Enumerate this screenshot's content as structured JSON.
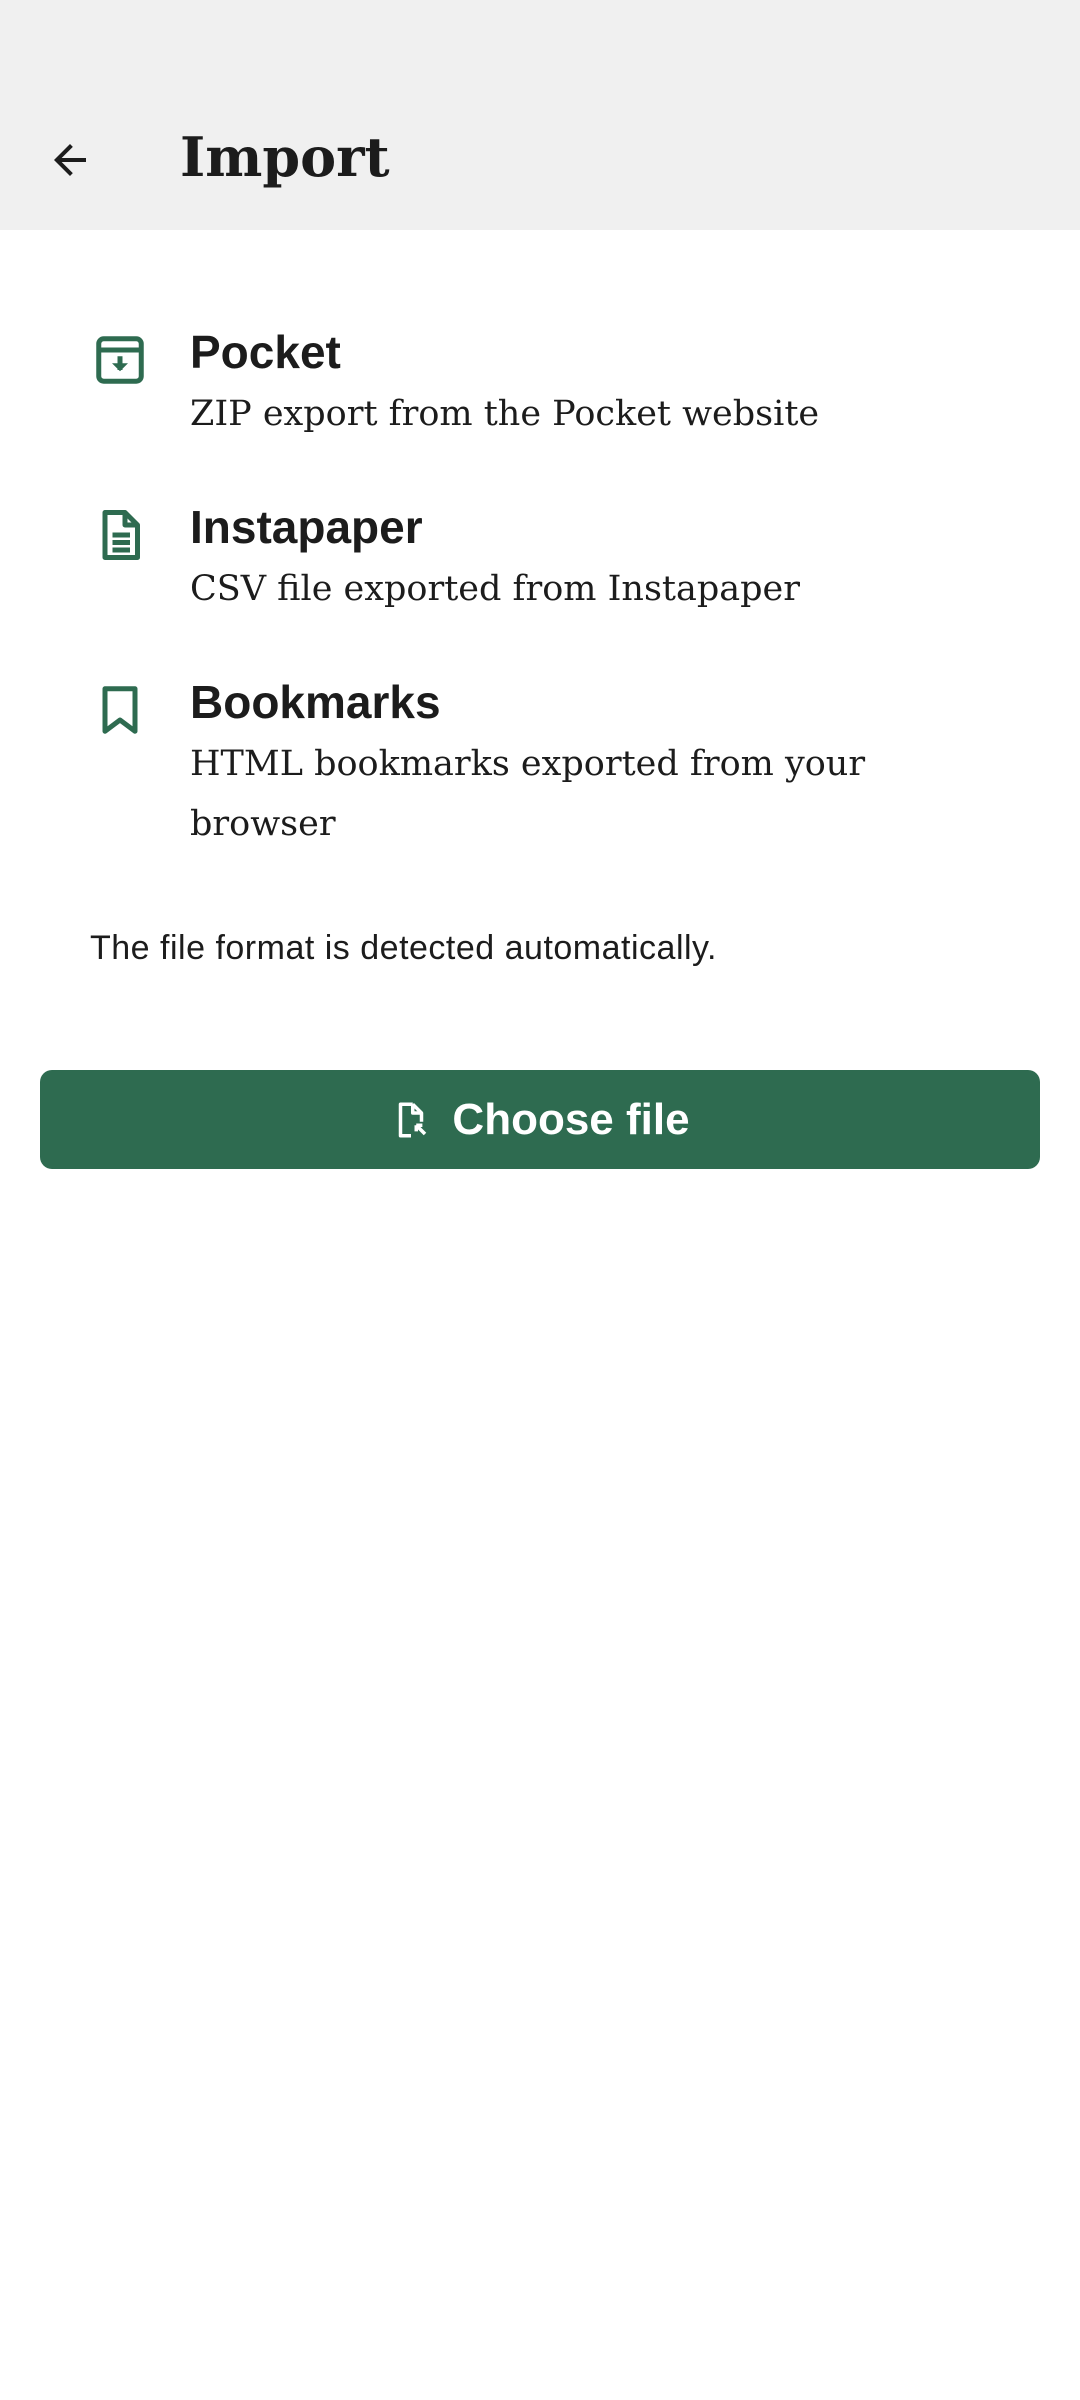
{
  "app_bar": {
    "title": "Import",
    "back_icon": "arrow-back-icon"
  },
  "sources": [
    {
      "icon": "archive-download-icon",
      "title": "Pocket",
      "description": "ZIP export from the Pocket website"
    },
    {
      "icon": "document-icon",
      "title": "Instapaper",
      "description": "CSV file exported from Instapaper"
    },
    {
      "icon": "bookmark-icon",
      "title": "Bookmarks",
      "description": "HTML bookmarks exported from your browser"
    }
  ],
  "note": "The file format is detected automatically.",
  "choose_file": {
    "label": "Choose file",
    "icon": "file-pick-icon"
  },
  "colors": {
    "accent": "#2e6b50",
    "app_bar_bg": "#f0f0f0",
    "text": "#1c1c1c"
  }
}
